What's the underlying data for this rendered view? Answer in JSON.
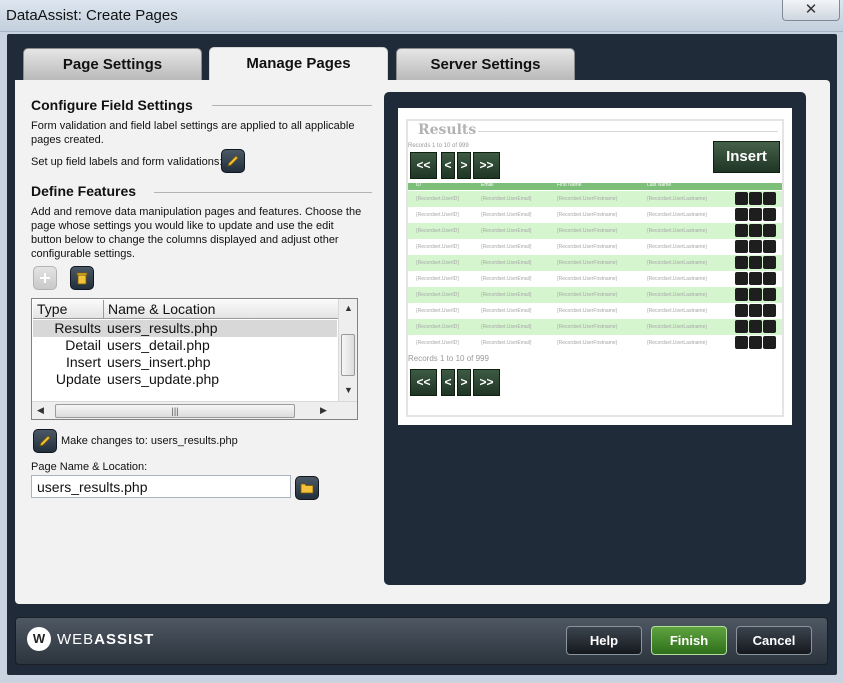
{
  "window": {
    "title": "DataAssist: Create Pages"
  },
  "tabs": [
    {
      "label": "Page Settings"
    },
    {
      "label": "Manage Pages"
    },
    {
      "label": "Server Settings"
    }
  ],
  "field_settings": {
    "title": "Configure Field Settings",
    "description": "Form validation and field label settings are applied to all applicable pages created.",
    "setup_label": "Set up field labels and form validations:"
  },
  "features": {
    "title": "Define Features",
    "description": "Add and remove data manipulation pages and features. Choose the page whose settings you would like to update and use the edit button below to change the columns displayed and adjust other configurable settings.",
    "columns": {
      "type": "Type",
      "location": "Name & Location"
    },
    "rows": [
      {
        "type": "Results",
        "location": "users_results.php",
        "selected": true
      },
      {
        "type": "Detail",
        "location": "users_detail.php"
      },
      {
        "type": "Insert",
        "location": "users_insert.php"
      },
      {
        "type": "Update",
        "location": "users_update.php"
      }
    ],
    "make_changes_label": "Make changes to: users_results.php",
    "page_name_label": "Page Name & Location:",
    "page_name_value": "users_results.php"
  },
  "preview": {
    "title": "Results",
    "records_top": "Records 1 to 10 of 999",
    "records_bottom": "Records 1 to 10 of 999",
    "nav": {
      "first": "<<",
      "prev": "<",
      "next": ">",
      "last": ">>"
    },
    "insert_label": "Insert",
    "headers": [
      "ID",
      "Email",
      "First Name",
      "Last Name"
    ],
    "cells": [
      "{Recordset.UserID}",
      "{Recordset.UserEmail}",
      "{Recordset.UserFirstname}",
      "{Recordset.UserLastname}"
    ]
  },
  "footer": {
    "logo_mark": "W",
    "logo_text_light": "WEB",
    "logo_text_bold": "ASSIST",
    "help": "Help",
    "finish": "Finish",
    "cancel": "Cancel"
  },
  "colors": {
    "frame": "#1f2b38",
    "accent_green": "#4f9a32",
    "preview_row_alt": "#d5f5cf"
  }
}
